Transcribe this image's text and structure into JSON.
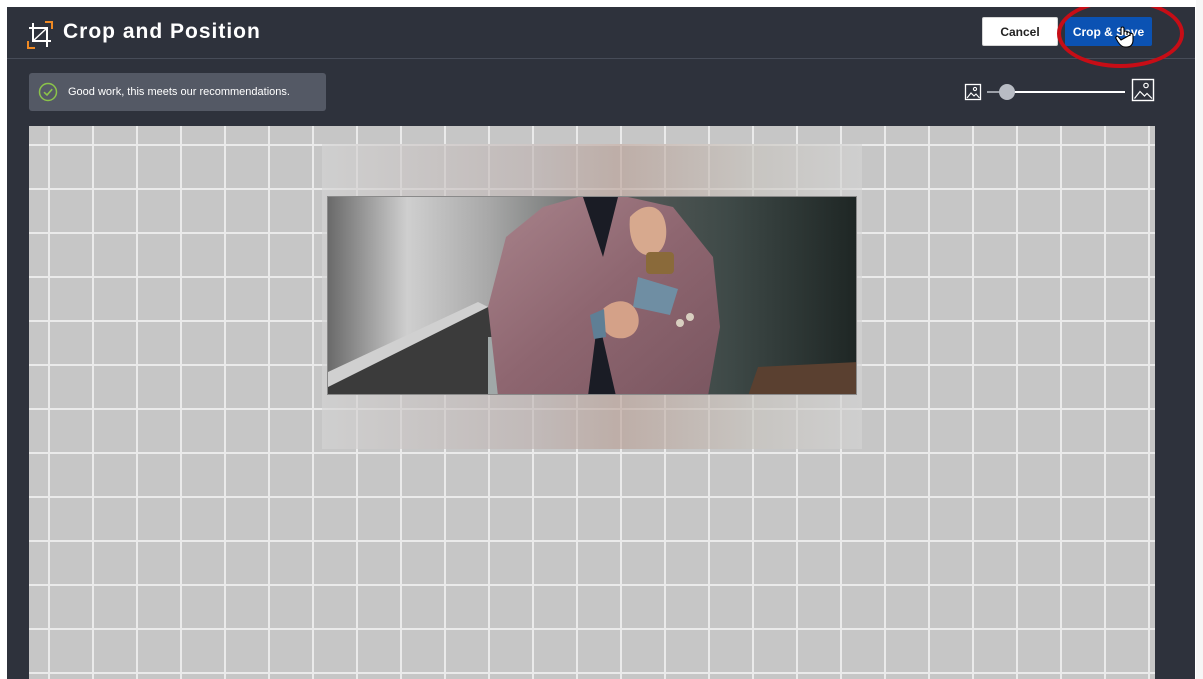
{
  "header": {
    "title": "Crop and Position",
    "cancel_label": "Cancel",
    "save_label": "Crop & Save"
  },
  "notice": {
    "text": "Good work, this meets our recommendations.",
    "icon": "check-circle-icon"
  },
  "zoom": {
    "min_icon": "image-small-icon",
    "max_icon": "image-large-icon",
    "level": 0.0
  },
  "colors": {
    "background": "#2e323c",
    "accent": "#0b52b3",
    "highlight": "#c70d16",
    "success": "#8bc34a",
    "crop_icon_orange": "#f08a24"
  }
}
